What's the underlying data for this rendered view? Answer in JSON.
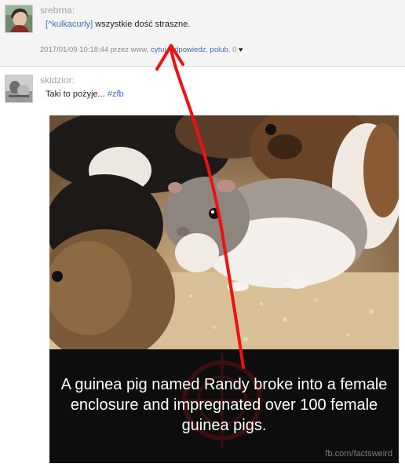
{
  "posts": [
    {
      "username": "srebrna:",
      "mention": "[^kulkacurly]",
      "text": " wszystkie dość straszne.",
      "meta": {
        "prefix": "2017/01/09 10:18:44 przez www, ",
        "link1": "cytuj",
        "sep1": ", ",
        "link2": "odpowiedz",
        "sep2": ", ",
        "link3": "polub",
        "sep3": ", ",
        "likes": "0 "
      }
    },
    {
      "username": "skidzior:",
      "text": "Taki to pożyje... ",
      "hashtag": "#zfb",
      "image": {
        "caption": "A guinea pig named Randy broke into a female enclosure and impregnated over 100 female guinea pigs.",
        "credit": "fb.com/factsweird"
      }
    }
  ],
  "colors": {
    "link": "#3b6fb6",
    "annotation": "#ee1111"
  },
  "icons": [
    "heart-icon"
  ]
}
